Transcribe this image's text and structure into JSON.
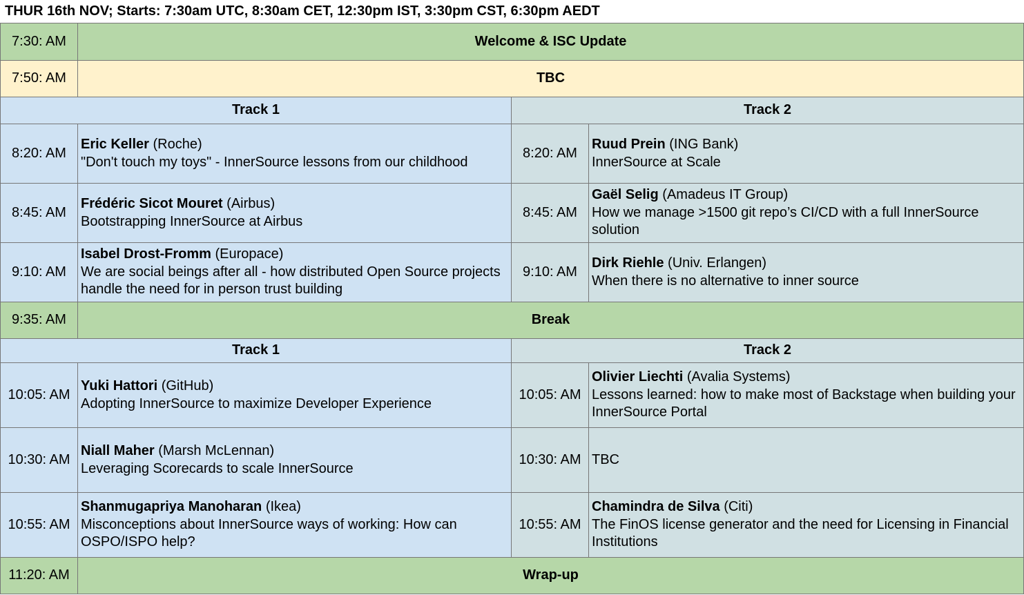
{
  "header": "THUR 16th NOV; Starts: 7:30am UTC, 8:30am CET, 12:30pm IST, 3:30pm CST, 6:30pm AEDT",
  "colors": {
    "plenary": "#b6d7a8",
    "tbc": "#fff2cc",
    "track1": "#cfe2f3",
    "track2": "#d0e0e3"
  },
  "plenary": {
    "welcome": {
      "time": "7:30: AM",
      "title": "Welcome & ISC Update"
    },
    "tbc": {
      "time": "7:50: AM",
      "title": "TBC"
    },
    "break": {
      "time": "9:35: AM",
      "title": "Break"
    },
    "wrapup": {
      "time": "11:20: AM",
      "title": "Wrap-up"
    }
  },
  "session1": {
    "track1_label": "Track 1",
    "track2_label": "Track 2",
    "rows": [
      {
        "t1": {
          "time": "8:20: AM",
          "speaker": "Eric Keller",
          "org": "(Roche)",
          "title": "\"Don't touch my toys\" - InnerSource lessons from our childhood"
        },
        "t2": {
          "time": "8:20: AM",
          "speaker": "Ruud Prein",
          "org": "(ING Bank)",
          "title": "InnerSource at Scale"
        }
      },
      {
        "t1": {
          "time": "8:45: AM",
          "speaker": "Frédéric Sicot Mouret",
          "org": "(Airbus)",
          "title": "Bootstrapping InnerSource at Airbus"
        },
        "t2": {
          "time": "8:45: AM",
          "speaker": "Gaël Selig",
          "org": "(Amadeus IT Group)",
          "title": "How we manage >1500 git repo’s CI/CD with a full InnerSource solution"
        }
      },
      {
        "t1": {
          "time": "9:10: AM",
          "speaker": "Isabel Drost-Fromm",
          "org": "(Europace)",
          "title": "We are social beings after all - how distributed Open Source projects handle the need for in person trust building"
        },
        "t2": {
          "time": "9:10: AM",
          "speaker": "Dirk Riehle",
          "org": "(Univ. Erlangen)",
          "title": "When there is no alternative to inner source"
        }
      }
    ]
  },
  "session2": {
    "track1_label": "Track 1",
    "track2_label": "Track 2",
    "rows": [
      {
        "t1": {
          "time": "10:05: AM",
          "speaker": "Yuki Hattori",
          "org": "(GitHub)",
          "title": "Adopting InnerSource to maximize Developer Experience"
        },
        "t2": {
          "time": "10:05: AM",
          "speaker": "Olivier Liechti",
          "org": "(Avalia Systems)",
          "title": "Lessons learned: how to make most of Backstage when building your InnerSource Portal"
        }
      },
      {
        "t1": {
          "time": "10:30: AM",
          "speaker": "Niall Maher",
          "org": "(Marsh McLennan)",
          "title": "Leveraging Scorecards to scale InnerSource"
        },
        "t2": {
          "time": "10:30: AM",
          "text": "TBC"
        }
      },
      {
        "t1": {
          "time": "10:55: AM",
          "speaker": "Shanmugapriya Manoharan",
          "org": "(Ikea)",
          "title": "Misconceptions about InnerSource ways of working: How can OSPO/ISPO help?"
        },
        "t2": {
          "time": "10:55: AM",
          "speaker": "Chamindra de Silva",
          "org": "(Citi)",
          "title": "The FinOS license generator and the need for Licensing in Financial Institutions"
        }
      }
    ]
  }
}
